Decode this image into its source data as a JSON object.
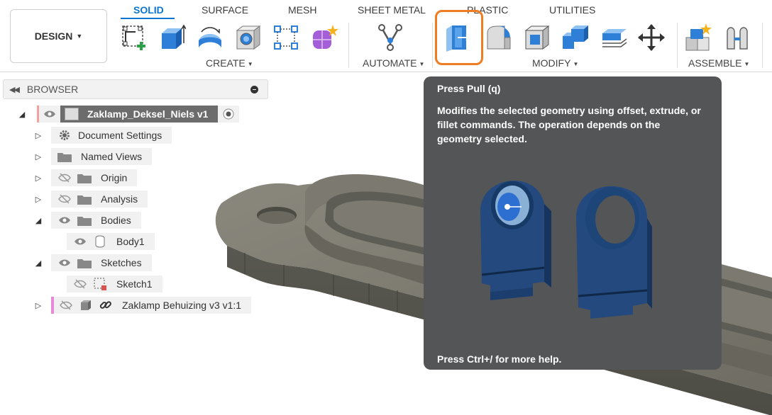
{
  "toolbar": {
    "design_label": "DESIGN",
    "tabs": [
      {
        "label": "SOLID"
      },
      {
        "label": "SURFACE"
      },
      {
        "label": "MESH"
      },
      {
        "label": "SHEET METAL"
      },
      {
        "label": "PLASTIC"
      },
      {
        "label": "UTILITIES"
      }
    ],
    "groups": {
      "create": "CREATE",
      "automate": "AUTOMATE",
      "modify": "MODIFY",
      "assemble": "ASSEMBLE"
    }
  },
  "browser": {
    "title": "BROWSER",
    "root": "Zaklamp_Deksel_Niels v1",
    "items": [
      {
        "label": "Document Settings"
      },
      {
        "label": "Named Views"
      },
      {
        "label": "Origin"
      },
      {
        "label": "Analysis"
      },
      {
        "label": "Bodies"
      },
      {
        "label": "Body1"
      },
      {
        "label": "Sketches"
      },
      {
        "label": "Sketch1"
      },
      {
        "label": "Zaklamp Behuizing v3 v1:1"
      }
    ]
  },
  "tooltip": {
    "title": "Press Pull (q)",
    "description": "Modifies the selected geometry using offset, extrude, or fillet commands. The operation depends on the geometry selected.",
    "help": "Press Ctrl+/ for more help."
  },
  "colors": {
    "accent": "#0b74d1",
    "highlight": "#f07c22",
    "tooltip_bg": "#545556",
    "model": "#6e6c62"
  }
}
